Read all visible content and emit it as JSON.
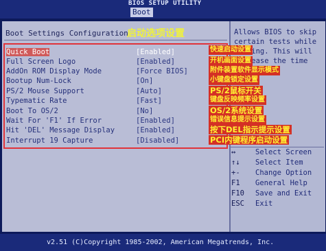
{
  "header": {
    "utility_title": "BIOS SETUP UTILITY",
    "tab": "Boot"
  },
  "panel": {
    "title": "Boot Settings Configuration",
    "title_cn": "启动选项设置"
  },
  "settings": [
    {
      "label": "Quick Boot",
      "value": "[Enabled]",
      "note": "快速启动设置"
    },
    {
      "label": "Full Screen Logo",
      "value": "[Enabled]",
      "note": "开机画面设置"
    },
    {
      "label": "AddOn ROM Display Mode",
      "value": "[Force BIOS]",
      "note": "附件装置软件显示模式"
    },
    {
      "label": "Bootup Num-Lock",
      "value": "[On]",
      "note": "小键盘锁定设置"
    },
    {
      "label": "PS/2 Mouse Support",
      "value": "[Auto]",
      "note": "PS/2鼠标开关"
    },
    {
      "label": "Typematic Rate",
      "value": "[Fast]",
      "note": "键盘反映频率设置"
    },
    {
      "label": "Boot To OS/2",
      "value": "[No]",
      "note": "OS/2系统设置"
    },
    {
      "label": "Wait For 'F1' If Error",
      "value": "[Enabled]",
      "note": "错误信息提示设置"
    },
    {
      "label": "Hit 'DEL' Message Display",
      "value": "[Enabled]",
      "note": "按下DEL指示提示设置"
    },
    {
      "label": "Interrupt 19 Capture",
      "value": "[Disabled]",
      "note": "PCI内键程序启动设置"
    }
  ],
  "help": {
    "lines": [
      "Allows BIOS to skip",
      "certain tests while",
      "booting. This will",
      "decrease the time"
    ]
  },
  "keys": [
    {
      "key": "↔",
      "desc": "Select Screen"
    },
    {
      "key": "↑↓",
      "desc": "Select Item"
    },
    {
      "key": "+-",
      "desc": "Change Option"
    },
    {
      "key": "F1",
      "desc": "General Help"
    },
    {
      "key": "F10",
      "desc": "Save and Exit"
    },
    {
      "key": "ESC",
      "desc": "Exit"
    }
  ],
  "footer": {
    "copyright": "v2.51 (C)Copyright 1985-2002, American Megatrends, Inc."
  },
  "colors": {
    "background": "#0d1a5a",
    "panel": "#b9bdd6",
    "annotation": "#d43025",
    "annotation_text": "#ffee33"
  }
}
